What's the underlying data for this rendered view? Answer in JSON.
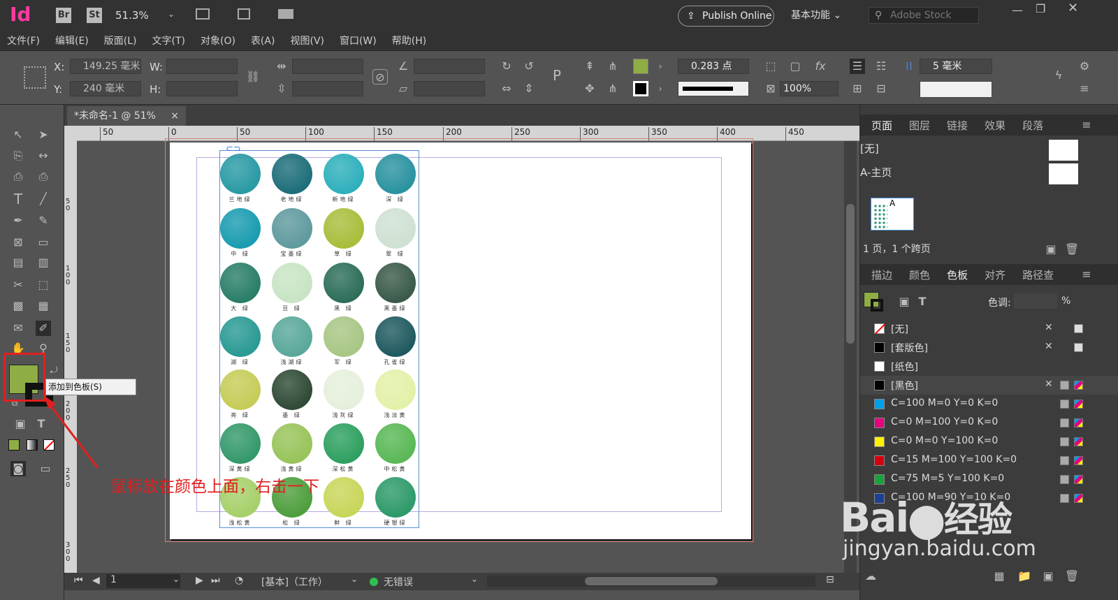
{
  "app": {
    "logo": "Id",
    "br": "Br",
    "st": "St",
    "zoom": "51.3%",
    "publish": "Publish Online",
    "workspace": "基本功能",
    "search_placeholder": "Adobe Stock"
  },
  "menu": [
    "文件(F)",
    "编辑(E)",
    "版面(L)",
    "文字(T)",
    "对象(O)",
    "表(A)",
    "视图(V)",
    "窗口(W)",
    "帮助(H)"
  ],
  "control": {
    "x_label": "X:",
    "x_value": "149.25 毫米",
    "y_label": "Y:",
    "y_value": "240 毫米",
    "w_label": "W:",
    "h_label": "H:",
    "stroke_weight": "0.283 点",
    "opacity": "100%",
    "gutter": "5 毫米"
  },
  "document": {
    "tab": "*未命名-1 @ 51%",
    "close": "×"
  },
  "ruler": {
    "h_ticks": [
      "50",
      "0",
      "50",
      "100",
      "150",
      "200",
      "250",
      "300",
      "350",
      "400",
      "450"
    ],
    "v_ticks": [
      "5 0",
      "1 0 0",
      "1 5 0",
      "2 0 0",
      "2 5 0",
      "3 0 0"
    ]
  },
  "swatches": [
    [
      "兰地绿",
      "老地绿",
      "新地绿",
      "深 绿"
    ],
    [
      "中 绿",
      "宝墨绿",
      "草 绿",
      "翠 绿"
    ],
    [
      "大 绿",
      "豆 绿",
      "黑 绿",
      "黑墨绿"
    ],
    [
      "湖 绿",
      "浅湖绿",
      "军 绿",
      "孔雀绿"
    ],
    [
      "亮 绿",
      "墨 绿",
      "浅灰绿",
      "浅淡黄"
    ],
    [
      "深黄绿",
      "浅黄绿",
      "深松黄",
      "中松黄"
    ],
    [
      "浅松黄",
      "松 绿",
      "鲜 绿",
      "硬银绿"
    ]
  ],
  "swatch_colors": [
    [
      "#2a9aa4",
      "#1d6e7a",
      "#2eb0bc",
      "#2a93a0"
    ],
    [
      "#1a9cb0",
      "#5f9a9e",
      "#a8be3c",
      "#cfe1d3"
    ],
    [
      "#2a7e68",
      "#c8e4c4",
      "#2d6e5a",
      "#3b5a4a"
    ],
    [
      "#2a9a94",
      "#5aa89a",
      "#a8c685",
      "#1f5a60"
    ],
    [
      "#c6cc58",
      "#2f4a36",
      "#e6efdc",
      "#e2f1a8"
    ],
    [
      "#34996a",
      "#98c45a",
      "#2ea060",
      "#5ab856"
    ],
    [
      "#a6d06a",
      "#4f9e3e",
      "#c8d65a",
      "#2e9a6a"
    ]
  ],
  "status": {
    "page": "1",
    "preflight_profile": "[基本]（工作）",
    "errors": "无错误"
  },
  "panels": {
    "pages_tabs": [
      "页面",
      "图层",
      "链接",
      "效果",
      "段落"
    ],
    "none_master": "[无]",
    "a_master": "A-主页",
    "page_letter": "A",
    "pages_info": "1 页，1 个跨页",
    "swatch_tabs": [
      "描边",
      "颜色",
      "色板",
      "对齐",
      "路径查"
    ],
    "tint_label": "色调:",
    "tint_unit": "%",
    "swatch_list": [
      {
        "name": "[无]",
        "color": "none"
      },
      {
        "name": "[套版色]",
        "color": "#000000"
      },
      {
        "name": "[纸色]",
        "color": "#ffffff"
      },
      {
        "name": "[黑色]",
        "color": "#000000"
      },
      {
        "name": "C=100 M=0 Y=0 K=0",
        "color": "#00a0e9"
      },
      {
        "name": "C=0 M=100 Y=0 K=0",
        "color": "#e4007f"
      },
      {
        "name": "C=0 M=0 Y=100 K=0",
        "color": "#fff100"
      },
      {
        "name": "C=15 M=100 Y=100 K=0",
        "color": "#d7000f"
      },
      {
        "name": "C=75 M=5 Y=100 K=0",
        "color": "#1aa23a"
      },
      {
        "name": "C=100 M=90 Y=10 K=0",
        "color": "#1d3f94"
      }
    ]
  },
  "fill_color": "#8fad45",
  "tooltip": "添加到色板(S)",
  "annotation": "鼠标放在颜色上面，右击一下",
  "watermark": {
    "brand_a": "Bai",
    "brand_b": "经验",
    "url": "jingyan.baidu.com"
  }
}
